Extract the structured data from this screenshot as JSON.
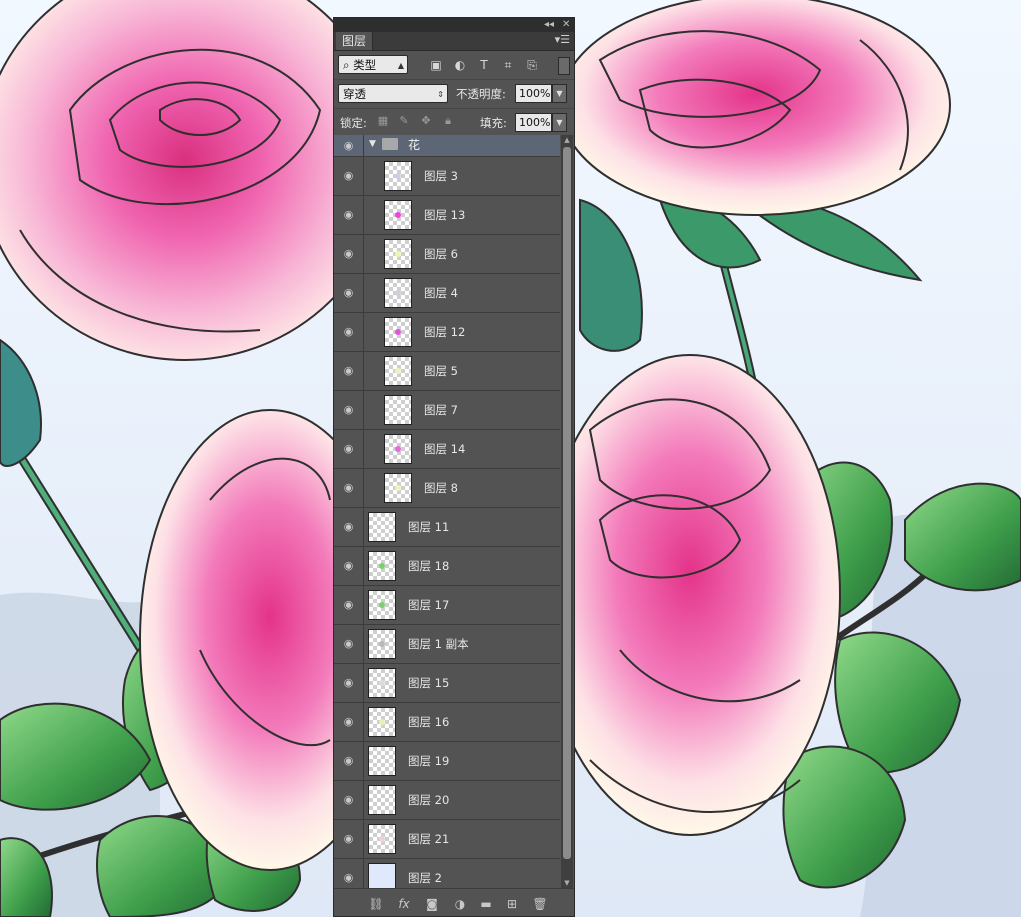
{
  "panel": {
    "tab_label": "图层",
    "filter_kind": "类型",
    "blend_mode": "穿透",
    "opacity_label": "不透明度:",
    "opacity_value": "100%",
    "lock_label": "锁定:",
    "fill_label": "填充:",
    "fill_value": "100%",
    "group": {
      "name": "花"
    },
    "layers": [
      {
        "name": "图层 3",
        "in_group": true,
        "dot": "#d8c9e8"
      },
      {
        "name": "图层 13",
        "in_group": true,
        "dot": "#ee44dd"
      },
      {
        "name": "图层 6",
        "in_group": true,
        "dot": "#f2f4b0"
      },
      {
        "name": "图层 4",
        "in_group": true,
        "dot": "#cfcfe0"
      },
      {
        "name": "图层 12",
        "in_group": true,
        "dot": "#e055dd"
      },
      {
        "name": "图层 5",
        "in_group": true,
        "dot": "#f3f1c0"
      },
      {
        "name": "图层 7",
        "in_group": true,
        "dot": ""
      },
      {
        "name": "图层 14",
        "in_group": true,
        "dot": "#e86ad8"
      },
      {
        "name": "图层 8",
        "in_group": true,
        "dot": "#f3f1c0"
      },
      {
        "name": "图层 11",
        "in_group": false,
        "dot": ""
      },
      {
        "name": "图层 18",
        "in_group": false,
        "dot": "#7ccf6e"
      },
      {
        "name": "图层 17",
        "in_group": false,
        "dot": "#7ccf6e"
      },
      {
        "name": "图层 1 副本",
        "in_group": false,
        "dot": "#b8b8b8"
      },
      {
        "name": "图层 15",
        "in_group": false,
        "dot": "#dcdcdc"
      },
      {
        "name": "图层 16",
        "in_group": false,
        "dot": "#e6f0b8"
      },
      {
        "name": "图层 19",
        "in_group": false,
        "dot": ""
      },
      {
        "name": "图层 20",
        "in_group": false,
        "dot": ""
      },
      {
        "name": "图层 21",
        "in_group": false,
        "dot": "#f0d0e0"
      },
      {
        "name": "图层 2",
        "in_group": false,
        "dot": "",
        "fill": "#dfe9fb"
      }
    ]
  },
  "colors": {
    "panel_bg": "#535353",
    "group_row": "#5d6675",
    "rose_pink": "#f05aa8",
    "leaf_green": "#4caf50",
    "sky": "#e8f0fa"
  }
}
